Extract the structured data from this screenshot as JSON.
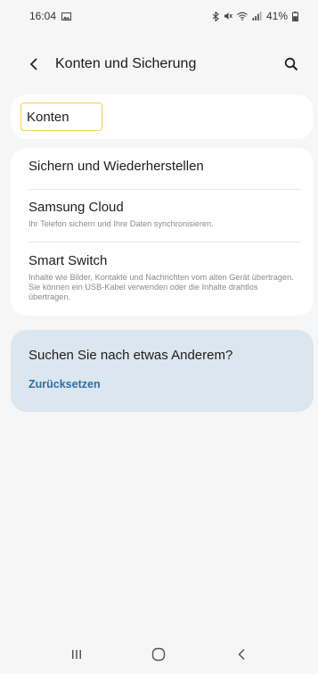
{
  "status_bar": {
    "time": "16:04",
    "battery": "41%"
  },
  "app_bar": {
    "title": "Konten und Sicherung"
  },
  "konten_card": {
    "label": "Konten"
  },
  "main_card": {
    "items": [
      {
        "title": "Sichern und Wiederherstellen",
        "subtitle": ""
      },
      {
        "title": "Samsung Cloud",
        "subtitle": "Ihr Telefon sichern und Ihre Daten synchronisieren."
      },
      {
        "title": "Smart Switch",
        "subtitle": "Inhalte wie Bilder, Kontakte und Nachrichten vom alten Gerät übertragen. Sie können ein USB-Kabel verwenden oder die Inhalte drahtlos übertragen."
      }
    ]
  },
  "suggest_card": {
    "title": "Suchen Sie nach etwas Anderem?",
    "link": "Zurücksetzen"
  },
  "icons": {
    "status_left": [
      "gallery-notification-icon"
    ],
    "status_right": [
      "bluetooth-icon",
      "mute-icon",
      "wifi-icon",
      "signal-icon",
      "battery-icon"
    ],
    "app_bar": [
      "back-arrow-icon",
      "search-icon"
    ],
    "nav": [
      "recent-apps-icon",
      "home-icon",
      "back-icon"
    ]
  },
  "colors": {
    "background": "#f6f6f6",
    "card": "#ffffff",
    "suggest_card": "#dce6ee",
    "link": "#2b6fa6",
    "focus_border": "#f2d24a"
  }
}
